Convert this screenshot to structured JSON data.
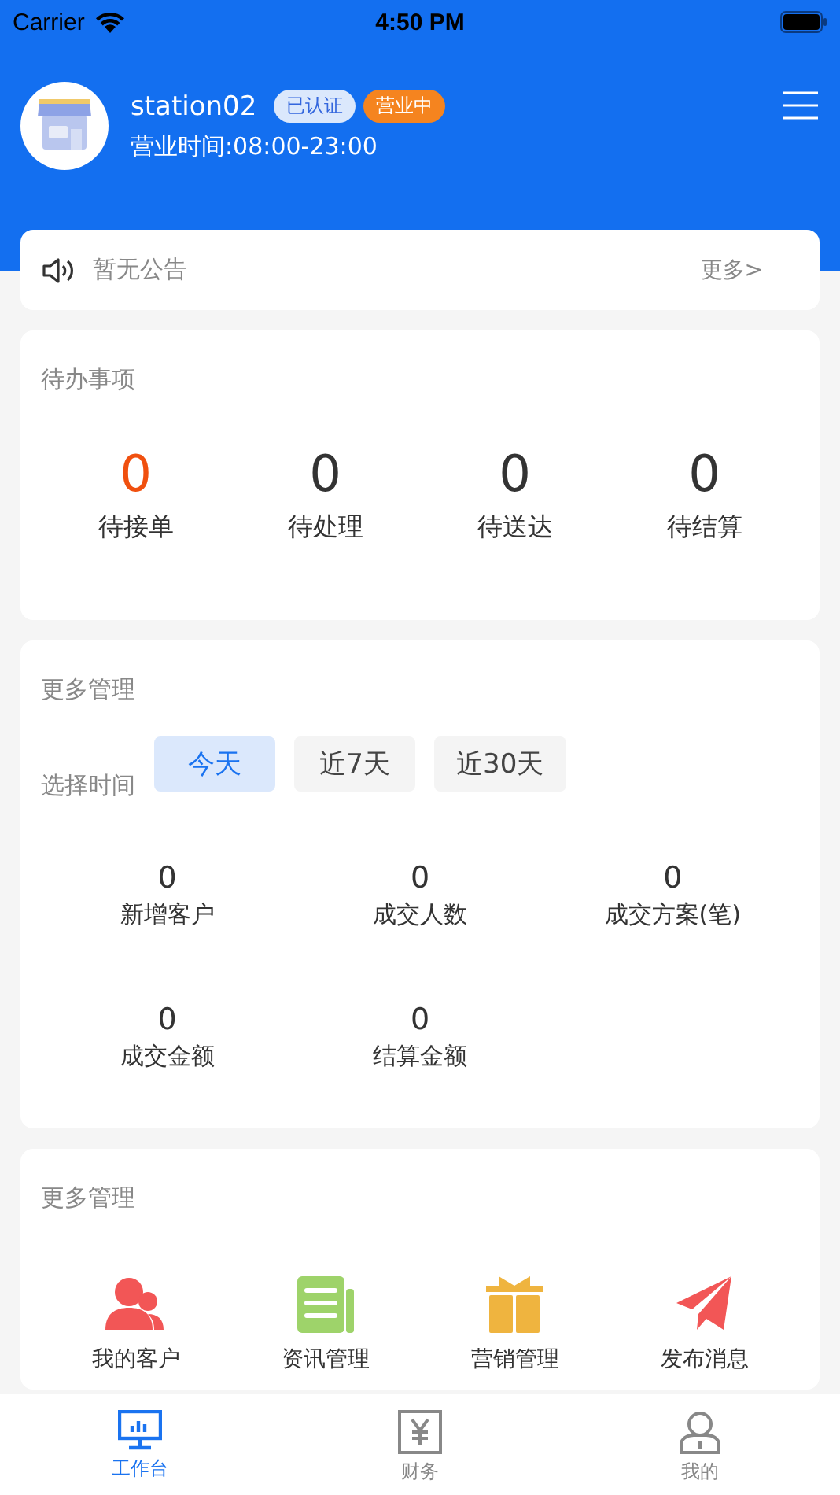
{
  "status_bar": {
    "carrier": "Carrier",
    "time": "4:50 PM"
  },
  "header": {
    "name": "station02",
    "badges": [
      {
        "label": "已认证",
        "kind": "verified"
      },
      {
        "label": "营业中",
        "kind": "open"
      }
    ],
    "hours": "营业时间:08:00-23:00"
  },
  "notice": {
    "text": "暂无公告",
    "more": "更多>"
  },
  "todo": {
    "title": "待办事项",
    "items": [
      {
        "count": "0",
        "label": "待接单",
        "color": "#f0500f"
      },
      {
        "count": "0",
        "label": "待处理",
        "color": "#333333"
      },
      {
        "count": "0",
        "label": "待送达",
        "color": "#333333"
      },
      {
        "count": "0",
        "label": "待结算",
        "color": "#333333"
      }
    ]
  },
  "stats": {
    "title": "更多管理",
    "time_label": "选择时间",
    "ranges": [
      {
        "label": "今天",
        "selected": true
      },
      {
        "label": "近7天",
        "selected": false
      },
      {
        "label": "近30天",
        "selected": false
      }
    ],
    "items": [
      {
        "value": "0",
        "label": "新增客户"
      },
      {
        "value": "0",
        "label": "成交人数"
      },
      {
        "value": "0",
        "label": "成交方案(笔)"
      },
      {
        "value": "0",
        "label": "成交金额"
      },
      {
        "value": "0",
        "label": "结算金额"
      }
    ]
  },
  "manage": {
    "title": "更多管理",
    "items": [
      {
        "label": "我的客户",
        "kind": "customers"
      },
      {
        "label": "资讯管理",
        "kind": "news"
      },
      {
        "label": "营销管理",
        "kind": "gift"
      },
      {
        "label": "发布消息",
        "kind": "send"
      }
    ]
  },
  "tab_bar": [
    {
      "label": "工作台",
      "kind": "desk",
      "selected": true
    },
    {
      "label": "财务",
      "kind": "finance",
      "selected": false
    },
    {
      "label": "我的",
      "kind": "me",
      "selected": false
    }
  ]
}
